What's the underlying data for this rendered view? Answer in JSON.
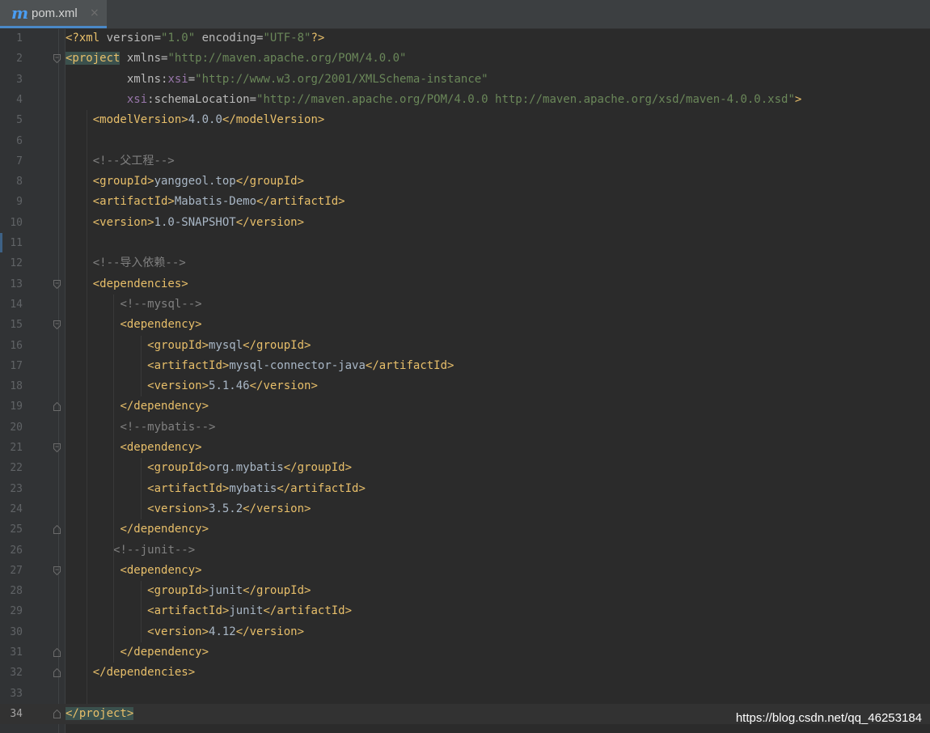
{
  "tab": {
    "icon": "m",
    "filename": "pom.xml",
    "close": "×"
  },
  "editor": {
    "current_line": 34
  },
  "lines": [
    [
      [
        "t",
        "<?xml "
      ],
      [
        "a",
        "version="
      ],
      [
        "v",
        "\"1.0\""
      ],
      [
        "a",
        " encoding="
      ],
      [
        "v",
        "\"UTF-8\""
      ],
      [
        "t",
        "?>"
      ]
    ],
    [
      [
        "t",
        "<project",
        "hl"
      ],
      [
        "a",
        " xmlns="
      ],
      [
        "v",
        "\"http://maven.apache.org/POM/4.0.0\""
      ]
    ],
    [
      [
        "x",
        "         "
      ],
      [
        "a",
        "xmlns:"
      ],
      [
        "ns",
        "xsi"
      ],
      [
        "a",
        "="
      ],
      [
        "v",
        "\"http://www.w3.org/2001/XMLSchema-instance\""
      ]
    ],
    [
      [
        "x",
        "         "
      ],
      [
        "ns",
        "xsi"
      ],
      [
        "a",
        ":schemaLocation="
      ],
      [
        "v",
        "\"http://maven.apache.org/POM/4.0.0 http://maven.apache.org/xsd/maven-4.0.0.xsd\""
      ],
      [
        "t",
        ">"
      ]
    ],
    [
      [
        "x",
        "    "
      ],
      [
        "t",
        "<modelVersion>"
      ],
      [
        "x",
        "4.0.0"
      ],
      [
        "t",
        "</modelVersion>"
      ]
    ],
    [],
    [
      [
        "x",
        "    "
      ],
      [
        "c",
        "<!--父工程-->"
      ]
    ],
    [
      [
        "x",
        "    "
      ],
      [
        "t",
        "<groupId>"
      ],
      [
        "x",
        "yanggeol.top"
      ],
      [
        "t",
        "</groupId>"
      ]
    ],
    [
      [
        "x",
        "    "
      ],
      [
        "t",
        "<artifactId>"
      ],
      [
        "x",
        "Mabatis-Demo"
      ],
      [
        "t",
        "</artifactId>"
      ]
    ],
    [
      [
        "x",
        "    "
      ],
      [
        "t",
        "<version>"
      ],
      [
        "x",
        "1.0-SNAPSHOT"
      ],
      [
        "t",
        "</version>"
      ]
    ],
    [],
    [
      [
        "x",
        "    "
      ],
      [
        "c",
        "<!--导入依赖-->"
      ]
    ],
    [
      [
        "x",
        "    "
      ],
      [
        "t",
        "<dependencies>"
      ]
    ],
    [
      [
        "x",
        "        "
      ],
      [
        "c",
        "<!--mysql-->"
      ]
    ],
    [
      [
        "x",
        "        "
      ],
      [
        "t",
        "<dependency>"
      ]
    ],
    [
      [
        "x",
        "            "
      ],
      [
        "t",
        "<groupId>"
      ],
      [
        "x",
        "mysql"
      ],
      [
        "t",
        "</groupId>"
      ]
    ],
    [
      [
        "x",
        "            "
      ],
      [
        "t",
        "<artifactId>"
      ],
      [
        "x",
        "mysql-connector-java"
      ],
      [
        "t",
        "</artifactId>"
      ]
    ],
    [
      [
        "x",
        "            "
      ],
      [
        "t",
        "<version>"
      ],
      [
        "x",
        "5.1.46"
      ],
      [
        "t",
        "</version>"
      ]
    ],
    [
      [
        "x",
        "        "
      ],
      [
        "t",
        "</dependency>"
      ]
    ],
    [
      [
        "x",
        "        "
      ],
      [
        "c",
        "<!--mybatis-->"
      ]
    ],
    [
      [
        "x",
        "        "
      ],
      [
        "t",
        "<dependency>"
      ]
    ],
    [
      [
        "x",
        "            "
      ],
      [
        "t",
        "<groupId>"
      ],
      [
        "x",
        "org.mybatis"
      ],
      [
        "t",
        "</groupId>"
      ]
    ],
    [
      [
        "x",
        "            "
      ],
      [
        "t",
        "<artifactId>"
      ],
      [
        "x",
        "mybatis"
      ],
      [
        "t",
        "</artifactId>"
      ]
    ],
    [
      [
        "x",
        "            "
      ],
      [
        "t",
        "<version>"
      ],
      [
        "x",
        "3.5.2"
      ],
      [
        "t",
        "</version>"
      ]
    ],
    [
      [
        "x",
        "        "
      ],
      [
        "t",
        "</dependency>"
      ]
    ],
    [
      [
        "x",
        "       "
      ],
      [
        "c",
        "<!--junit-->"
      ]
    ],
    [
      [
        "x",
        "        "
      ],
      [
        "t",
        "<dependency>"
      ]
    ],
    [
      [
        "x",
        "            "
      ],
      [
        "t",
        "<groupId>"
      ],
      [
        "x",
        "junit"
      ],
      [
        "t",
        "</groupId>"
      ]
    ],
    [
      [
        "x",
        "            "
      ],
      [
        "t",
        "<artifactId>"
      ],
      [
        "x",
        "junit"
      ],
      [
        "t",
        "</artifactId>"
      ]
    ],
    [
      [
        "x",
        "            "
      ],
      [
        "t",
        "<version>"
      ],
      [
        "x",
        "4.12"
      ],
      [
        "t",
        "</version>"
      ]
    ],
    [
      [
        "x",
        "        "
      ],
      [
        "t",
        "</dependency>"
      ]
    ],
    [
      [
        "x",
        "    "
      ],
      [
        "t",
        "</dependencies>"
      ]
    ],
    [],
    [
      [
        "t",
        "</project>",
        "hl"
      ]
    ]
  ],
  "fold_markers": {
    "2": "open",
    "13": "open",
    "15": "open",
    "19": "close",
    "21": "open",
    "25": "close",
    "27": "open",
    "31": "close",
    "32": "close",
    "34": "close"
  },
  "watermark": "https://blog.csdn.net/qq_46253184"
}
